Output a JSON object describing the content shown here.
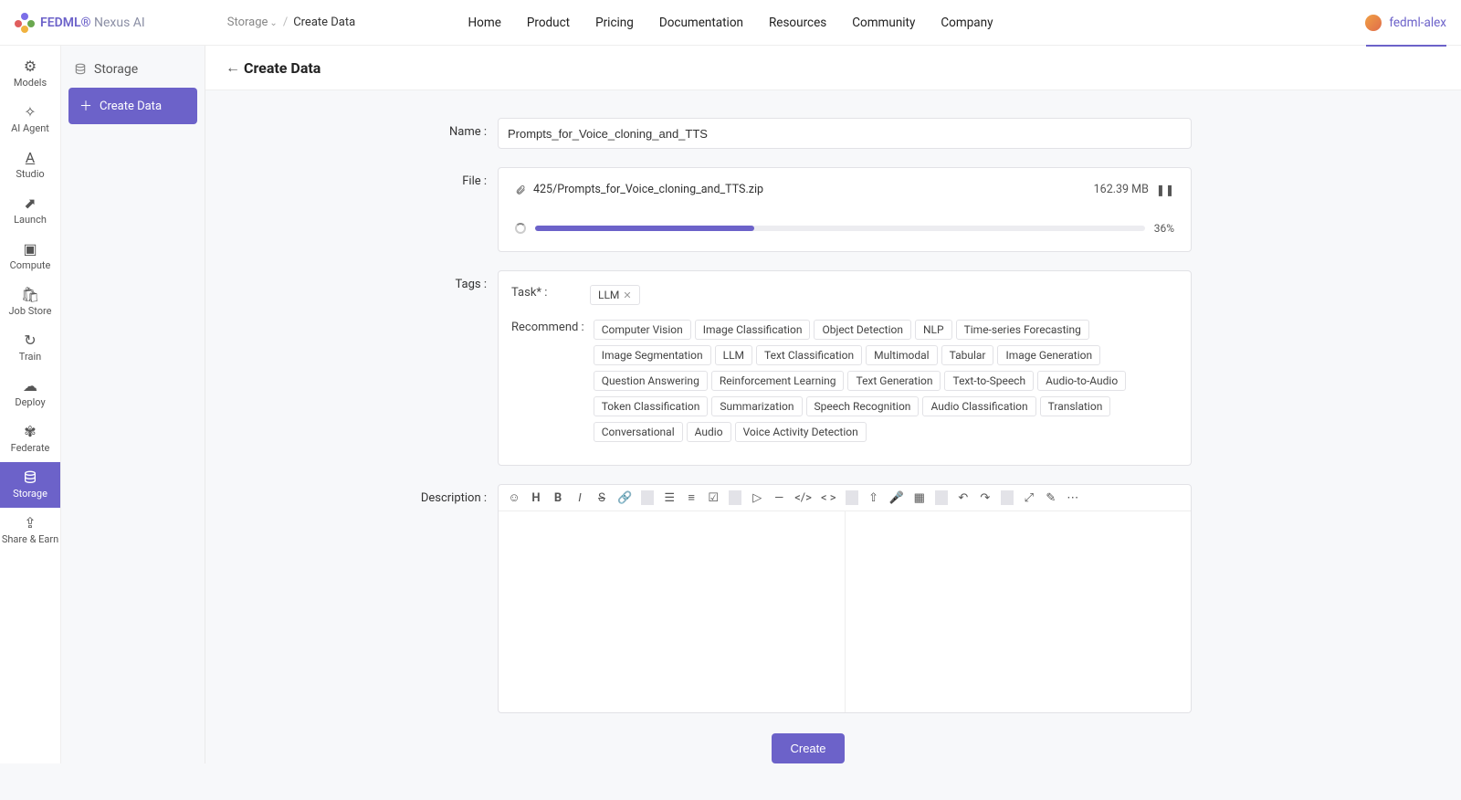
{
  "brand": {
    "name_bold": "FEDML®",
    "name_light": "Nexus AI"
  },
  "breadcrumb": {
    "parent": "Storage",
    "current": "Create Data"
  },
  "topnav": [
    "Home",
    "Product",
    "Pricing",
    "Documentation",
    "Resources",
    "Community",
    "Company"
  ],
  "account": {
    "username": "fedml-alex"
  },
  "rail": [
    {
      "label": "Models"
    },
    {
      "label": "AI Agent"
    },
    {
      "label": "Studio"
    },
    {
      "label": "Launch"
    },
    {
      "label": "Compute"
    },
    {
      "label": "Job Store"
    },
    {
      "label": "Train"
    },
    {
      "label": "Deploy"
    },
    {
      "label": "Federate"
    },
    {
      "label": "Storage",
      "active": true
    },
    {
      "label": "Share & Earn"
    }
  ],
  "side2": {
    "title": "Storage",
    "button": "Create Data"
  },
  "page": {
    "back_arrow": "←",
    "title": "Create Data"
  },
  "form": {
    "name": {
      "label": "Name :",
      "value": "Prompts_for_Voice_cloning_and_TTS"
    },
    "file": {
      "label": "File :",
      "filename": "425/Prompts_for_Voice_cloning_and_TTS.zip",
      "size": "162.39 MB",
      "progress_pct": "36%",
      "progress_width": "36%"
    },
    "tags": {
      "label": "Tags :",
      "task_label": "Task* :",
      "task_selected": "LLM",
      "recommend_label": "Recommend :",
      "recommend": [
        "Computer Vision",
        "Image Classification",
        "Object Detection",
        "NLP",
        "Time-series Forecasting",
        "Image Segmentation",
        "LLM",
        "Text Classification",
        "Multimodal",
        "Tabular",
        "Image Generation",
        "Question Answering",
        "Reinforcement Learning",
        "Text Generation",
        "Text-to-Speech",
        "Audio-to-Audio",
        "Token Classification",
        "Summarization",
        "Speech Recognition",
        "Audio Classification",
        "Translation",
        "Conversational",
        "Audio",
        "Voice Activity Detection"
      ]
    },
    "description": {
      "label": "Description :"
    },
    "submit": "Create"
  }
}
